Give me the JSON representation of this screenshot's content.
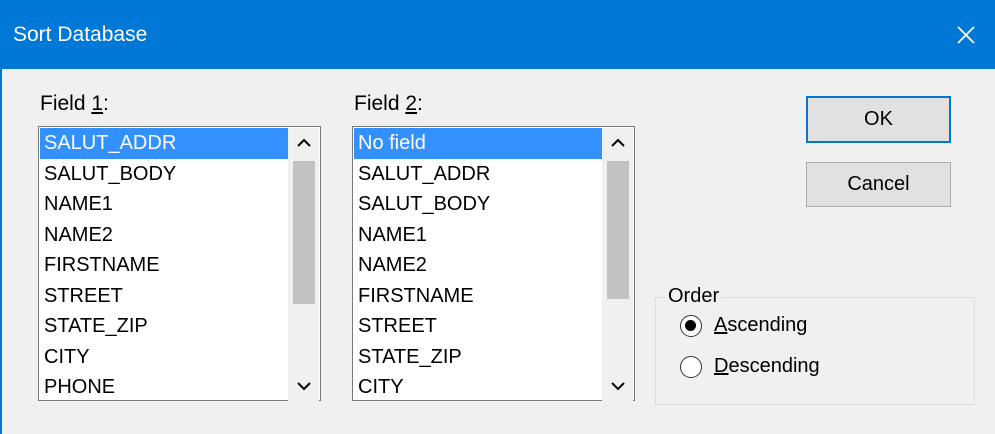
{
  "window": {
    "title": "Sort Database"
  },
  "field1": {
    "label_prefix": "Field ",
    "label_accel": "1",
    "label_suffix": ":",
    "items": [
      "SALUT_ADDR",
      "SALUT_BODY",
      "NAME1",
      "NAME2",
      "FIRSTNAME",
      "STREET",
      "STATE_ZIP",
      "CITY",
      "PHONE"
    ],
    "selected": "SALUT_ADDR"
  },
  "field2": {
    "label_prefix": "Field ",
    "label_accel": "2",
    "label_suffix": ":",
    "items": [
      "No field",
      "SALUT_ADDR",
      "SALUT_BODY",
      "NAME1",
      "NAME2",
      "FIRSTNAME",
      "STREET",
      "STATE_ZIP",
      "CITY"
    ],
    "selected": "No field"
  },
  "buttons": {
    "ok": "OK",
    "cancel": "Cancel"
  },
  "order": {
    "legend": "Order",
    "ascending_accel": "A",
    "ascending_rest": "scending",
    "descending_accel": "D",
    "descending_rest": "escending",
    "selected": "ascending"
  },
  "icons": {
    "close": "close-icon",
    "scroll_up": "chevron-up-icon",
    "scroll_down": "chevron-down-icon"
  }
}
